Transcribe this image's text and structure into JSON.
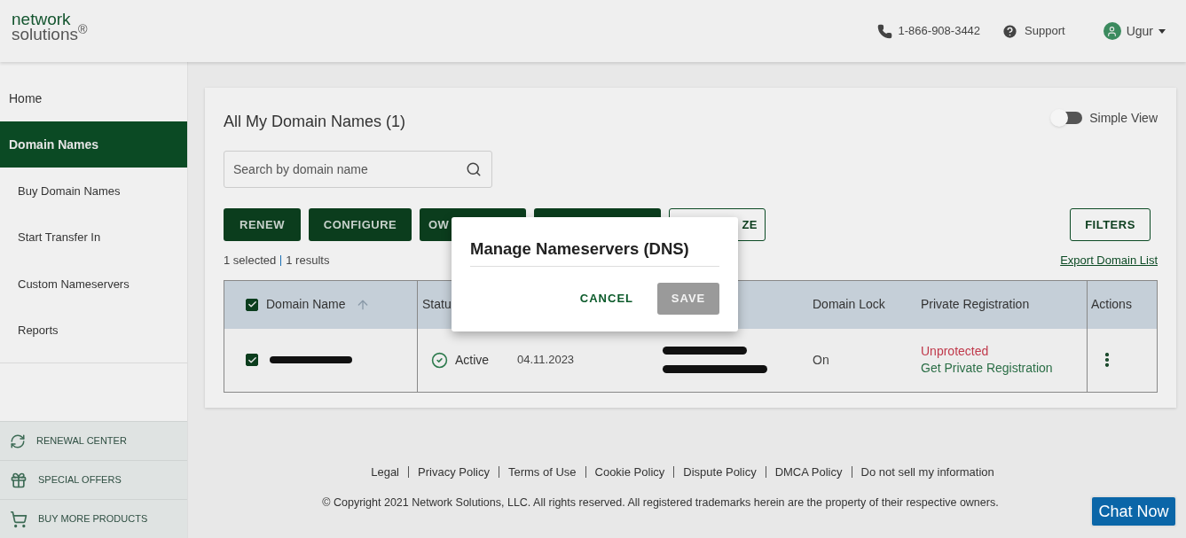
{
  "header": {
    "logo_top": "network",
    "logo_bottom": "solutions$^{®}$",
    "phone": "1-866-908-3442",
    "support": "Support",
    "user": "Ugur"
  },
  "sidebar": {
    "items": [
      {
        "label": "Home",
        "kind": "top",
        "selected": false
      },
      {
        "label": "Domain Names",
        "kind": "top",
        "selected": true
      },
      {
        "label": "Buy Domain Names",
        "kind": "sub",
        "selected": false
      },
      {
        "label": "Start Transfer In",
        "kind": "sub",
        "selected": false
      },
      {
        "label": "Custom Nameservers",
        "kind": "sub",
        "selected": false
      },
      {
        "label": "Reports",
        "kind": "sub",
        "selected": false
      }
    ],
    "promos": [
      {
        "label": "RENEWAL CENTER",
        "kind": "renew"
      },
      {
        "label": "SPECIAL OFFERS",
        "kind": "offers"
      },
      {
        "label": "BUY MORE PRODUCTS",
        "kind": "cart"
      }
    ]
  },
  "main": {
    "title": "All My Domain Names (1)",
    "simple_view": {
      "label": "Simple View",
      "on": false
    },
    "search": {
      "placeholder": "Search by domain name"
    },
    "actions": [
      {
        "label": "RENEW",
        "kind": "filled"
      },
      {
        "label": "CONFIGURE",
        "kind": "filled"
      },
      {
        "label": "OW",
        "kind": "filled"
      },
      {
        "kind": "filled"
      },
      {
        "label": "ZE",
        "kind": "outline"
      }
    ],
    "filters": "FILTERS",
    "selected_count": "1 selected",
    "results": "1 results",
    "export": "Export Domain List",
    "table": {
      "all_checked": true,
      "columns": [
        "Domain Name",
        "Statu",
        "Domain Lock",
        "Private Registration",
        "Actions"
      ],
      "rows": [
        {
          "checked": true,
          "status": "Active",
          "date": "04.11.2023",
          "domain_lock": "On",
          "privacy": "Unprotected",
          "privacy_link": "Get Private Registration"
        }
      ]
    }
  },
  "modal": {
    "title": "Manage Nameservers (DNS)",
    "cancel": "CANCEL",
    "save": {
      "label": "SAVE",
      "disabled": true
    }
  },
  "footer": {
    "links": [
      "Legal",
      "Privacy Policy",
      "Terms of Use",
      "Cookie Policy",
      "Dispute Policy",
      "DMCA Policy",
      "Do not sell my information"
    ],
    "copyright": "© Copyright 2021 Network Solutions, LLC. All rights reserved. All registered trademarks herein are the property of their respective owners."
  },
  "chat": "Chat Now"
}
